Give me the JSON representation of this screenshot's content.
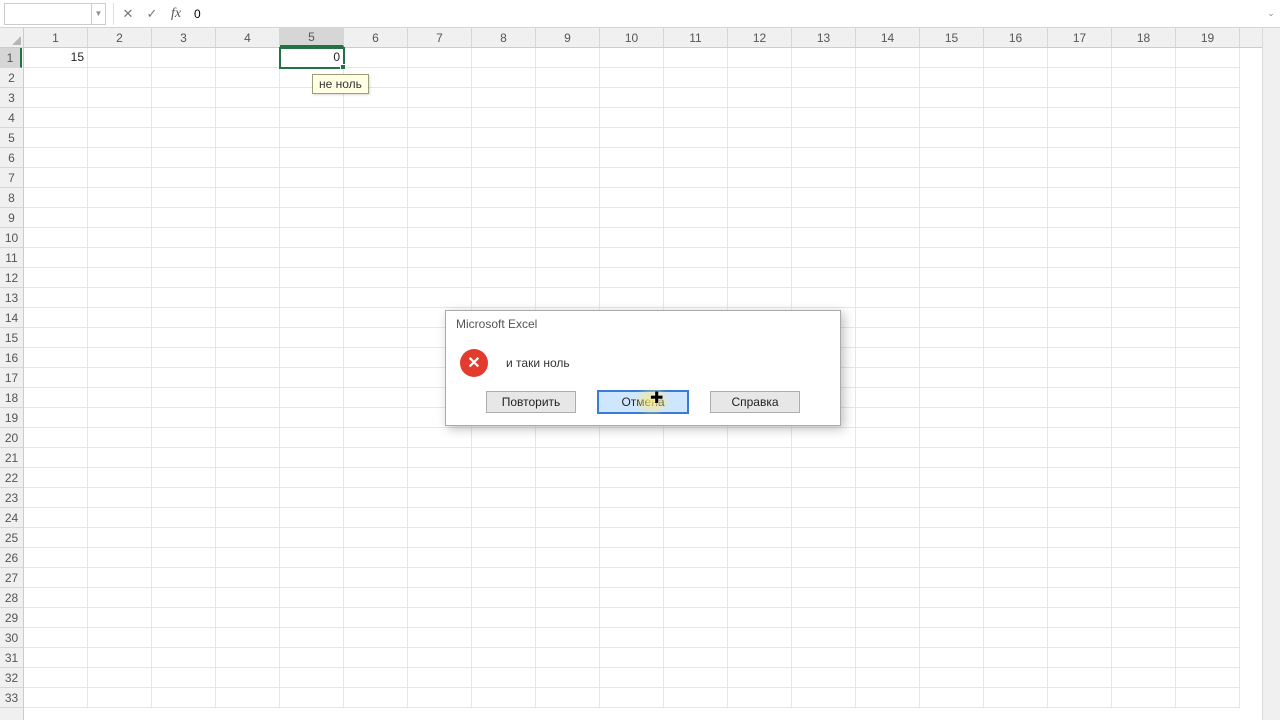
{
  "formulaBar": {
    "nameBox": "",
    "cancelGlyph": "✕",
    "enterGlyph": "✓",
    "fxLabel": "fx",
    "value": "0"
  },
  "columns": [
    "1",
    "2",
    "3",
    "4",
    "5",
    "6",
    "7",
    "8",
    "9",
    "10",
    "11",
    "12",
    "13",
    "14",
    "15",
    "16",
    "17",
    "18",
    "19"
  ],
  "rows": [
    "1",
    "2",
    "3",
    "4",
    "5",
    "6",
    "7",
    "8",
    "9",
    "10",
    "11",
    "12",
    "13",
    "14",
    "15",
    "16",
    "17",
    "18",
    "19",
    "20",
    "21",
    "22",
    "23",
    "24",
    "25",
    "26",
    "27",
    "28",
    "29",
    "30",
    "31",
    "32",
    "33"
  ],
  "activeColumnIndex": 4,
  "activeRowIndex": 0,
  "cellData": {
    "r0c0": "15",
    "r0c4": "0"
  },
  "tooltip": {
    "text": "не ноль"
  },
  "dialog": {
    "title": "Microsoft Excel",
    "message": "и таки ноль",
    "buttons": {
      "retry": "Повторить",
      "cancel": "Отмена",
      "help": "Справка"
    }
  }
}
